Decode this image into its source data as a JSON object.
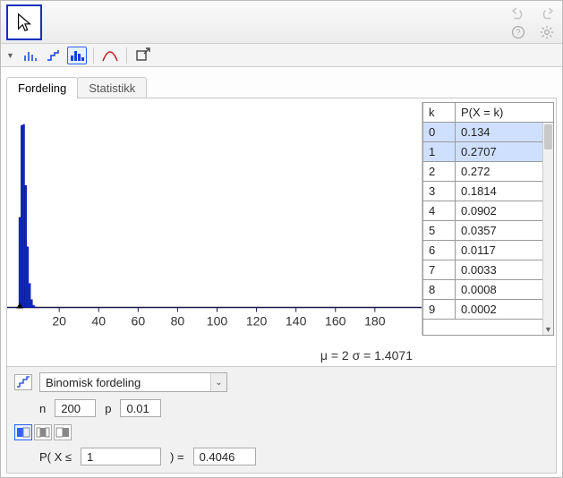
{
  "tabs": {
    "distribution": "Fordeling",
    "statistics": "Statistikk"
  },
  "axis_ticks": [
    "20",
    "40",
    "60",
    "80",
    "100",
    "120",
    "140",
    "160",
    "180"
  ],
  "stats_line": "μ = 2   σ = 1.4071",
  "table": {
    "head_k": "k",
    "head_p": "P(X = k)",
    "rows": [
      {
        "k": "0",
        "p": "0.134",
        "sel": true
      },
      {
        "k": "1",
        "p": "0.2707",
        "sel": true
      },
      {
        "k": "2",
        "p": "0.272",
        "sel": false
      },
      {
        "k": "3",
        "p": "0.1814",
        "sel": false
      },
      {
        "k": "4",
        "p": "0.0902",
        "sel": false
      },
      {
        "k": "5",
        "p": "0.0357",
        "sel": false
      },
      {
        "k": "6",
        "p": "0.0117",
        "sel": false
      },
      {
        "k": "7",
        "p": "0.0033",
        "sel": false
      },
      {
        "k": "8",
        "p": "0.0008",
        "sel": false
      },
      {
        "k": "9",
        "p": "0.0002",
        "sel": false
      }
    ]
  },
  "controls": {
    "distribution_name": "Binomisk fordeling",
    "n_label": "n",
    "n_value": "200",
    "p_label": "p",
    "p_value": "0.01",
    "prob_prefix": "P( X ≤",
    "prob_x": "1",
    "prob_mid": ") =",
    "prob_result": "0.4046"
  },
  "chart_data": {
    "type": "bar",
    "title": "",
    "xlabel": "",
    "ylabel": "",
    "xlim": [
      0,
      200
    ],
    "ylim": [
      0,
      0.3
    ],
    "ticks_x": [
      20,
      40,
      60,
      80,
      100,
      120,
      140,
      160,
      180
    ],
    "mu": 2,
    "sigma": 1.4071,
    "highlight_k_leq": 1,
    "categories": [
      0,
      1,
      2,
      3,
      4,
      5,
      6,
      7,
      8,
      9
    ],
    "values": [
      0.134,
      0.2707,
      0.272,
      0.1814,
      0.0902,
      0.0357,
      0.0117,
      0.0033,
      0.0008,
      0.0002
    ],
    "cumulative_P_X_leq_1": 0.4046
  }
}
